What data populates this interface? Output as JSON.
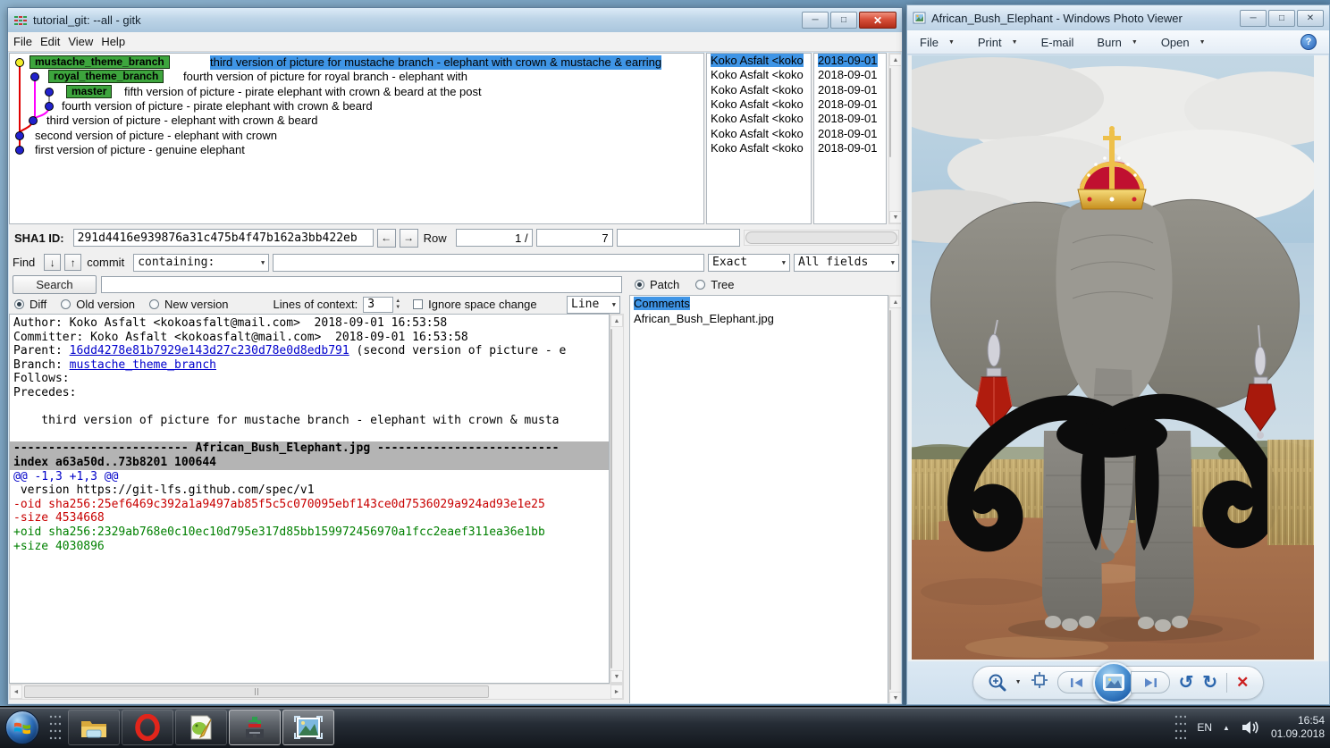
{
  "gitk": {
    "window_title": "tutorial_git: --all - gitk",
    "menu": {
      "items": [
        "File",
        "Edit",
        "View",
        "Help"
      ]
    },
    "commit_list": {
      "rows": [
        {
          "branch": "mustache_theme_branch",
          "message": "third version of picture for mustache branch - elephant with crown & mustache & earring",
          "author": "Koko Asfalt <koko",
          "date": "2018-09-01"
        },
        {
          "branch": "royal_theme_branch",
          "message": "fourth version of picture for royal branch - elephant with",
          "author": "Koko Asfalt <koko",
          "date": "2018-09-01"
        },
        {
          "branch": "master",
          "message": "fifth version of picture - pirate elephant with crown & beard at the post",
          "author": "Koko Asfalt <koko",
          "date": "2018-09-01"
        },
        {
          "branch": "",
          "message": "fourth version of picture - pirate elephant with crown & beard",
          "author": "Koko Asfalt <koko",
          "date": "2018-09-01"
        },
        {
          "branch": "",
          "message": "third version of picture - elephant with crown & beard",
          "author": "Koko Asfalt <koko",
          "date": "2018-09-01"
        },
        {
          "branch": "",
          "message": "second version of picture - elephant with crown",
          "author": "Koko Asfalt <koko",
          "date": "2018-09-01"
        },
        {
          "branch": "",
          "message": "first version of picture - genuine elephant",
          "author": "Koko Asfalt <koko",
          "date": "2018-09-01"
        }
      ]
    },
    "sha_bar": {
      "label": "SHA1 ID:",
      "value": "291d4416e939876a31c475b4f47b162a3bb422eb",
      "row_label": "Row",
      "row_current": "1 /",
      "row_total": "7"
    },
    "find_bar": {
      "find_label": "Find",
      "commit_label": "commit",
      "containing_value": "containing:",
      "exact_value": "Exact",
      "fields_value": "All fields"
    },
    "search_bar": {
      "button_label": "Search"
    },
    "diff_bar": {
      "diff_label": "Diff",
      "old_label": "Old version",
      "new_label": "New version",
      "context_label": "Lines of context:",
      "context_value": "3",
      "ignore_label": "Ignore space change",
      "line_label": "Line"
    },
    "right_panel": {
      "patch_label": "Patch",
      "tree_label": "Tree",
      "items": [
        "Comments",
        "African_Bush_Elephant.jpg"
      ]
    },
    "details": {
      "author": "Author: Koko Asfalt <kokoasfalt@mail.com>  2018-09-01 16:53:58",
      "committer": "Committer: Koko Asfalt <kokoasfalt@mail.com>  2018-09-01 16:53:58",
      "parent_label": "Parent: ",
      "parent_link": "16dd4278e81b7929e143d27c230d78e0d8edb791",
      "parent_suffix": " (second version of picture - e",
      "branch_label": "Branch: ",
      "branch_link": "mustache_theme_branch",
      "follows": "Follows: ",
      "precedes": "Precedes: ",
      "subject": "    third version of picture for mustache branch - elephant with crown & musta",
      "file_header": "------------------------- African_Bush_Elephant.jpg --------------------------",
      "index_line": "index a63a50d..73b8201 100644",
      "hunk_line": "@@ -1,3 +1,3 @@",
      "context_line": " version https://git-lfs.github.com/spec/v1",
      "del_oid": "-oid sha256:25ef6469c392a1a9497ab85f5c5c070095ebf143ce0d7536029a924ad93e1e25",
      "del_size": "-size 4534668",
      "add_oid": "+oid sha256:2329ab768e0c10ec10d795e317d85bb159972456970a1fcc2eaef311ea36e1bb",
      "add_size": "+size 4030896"
    }
  },
  "photo_viewer": {
    "window_title": "African_Bush_Elephant - Windows Photo Viewer",
    "menu": {
      "file": "File",
      "print": "Print",
      "email": "E-mail",
      "burn": "Burn",
      "open": "Open"
    }
  },
  "taskbar": {
    "tray": {
      "language": "EN",
      "time": "16:54",
      "date": "01.09.2018"
    }
  },
  "icons": {
    "minimize": "─",
    "maximize": "□",
    "close": "✕",
    "back_arrow": "←",
    "forward_arrow": "→",
    "down_arrow": "↓",
    "up_arrow": "↑",
    "dropdown_arrow": "▼",
    "spin_up": "▲",
    "spin_down": "▼",
    "scroll_up": "▲",
    "scroll_down": "▼",
    "scroll_left": "◄",
    "scroll_right": "►",
    "help": "?",
    "rotate_ccw": "↺",
    "rotate_cw": "↻",
    "delete_x": "✕",
    "tray_up": "▲"
  },
  "colors": {
    "selection_blue": "#3f95e6",
    "branch_green": "#3da53d",
    "diff_del_red": "#c80000",
    "diff_add_green": "#008000",
    "hunk_blue": "#0000c8",
    "link_blue": "#0000cc"
  }
}
